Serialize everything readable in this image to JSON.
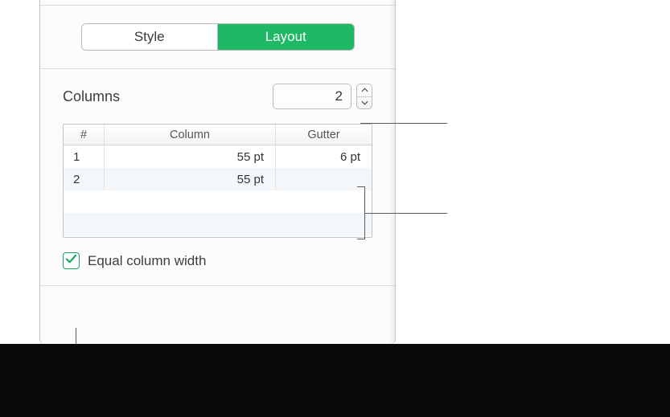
{
  "tabs": {
    "style": "Style",
    "layout": "Layout",
    "active": "layout"
  },
  "columns": {
    "label": "Columns",
    "value": "2",
    "headers": {
      "index": "#",
      "column": "Column",
      "gutter": "Gutter"
    },
    "rows": [
      {
        "index": "1",
        "column": "55 pt",
        "gutter": "6 pt"
      },
      {
        "index": "2",
        "column": "55 pt",
        "gutter": ""
      }
    ]
  },
  "equal_width": {
    "label": "Equal column width",
    "checked": true
  },
  "colors": {
    "accent": "#1fb866"
  }
}
